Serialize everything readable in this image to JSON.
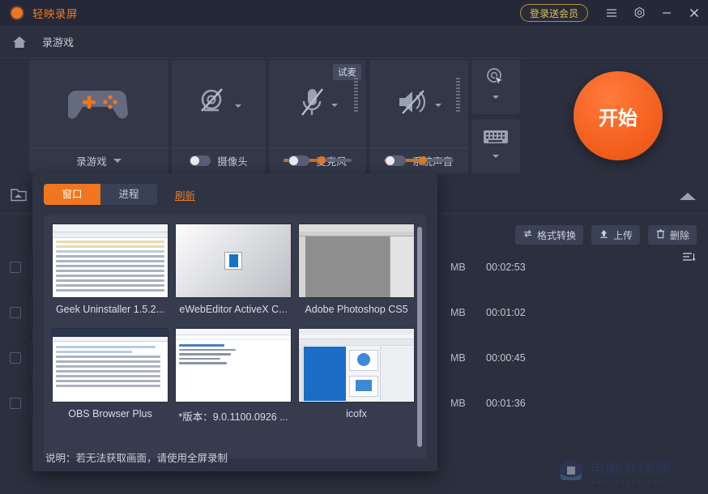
{
  "titlebar": {
    "app_title": "轻映录屏",
    "logo_icon": "record-dot-icon",
    "vip_button": "登录送会员",
    "menu_icon": "hamburger-menu-icon",
    "settings_icon": "gear-icon",
    "minimize_icon": "minimize-icon",
    "close_icon": "close-icon",
    "accent_color": "#f0761f",
    "vip_color": "#e0bf55"
  },
  "nav": {
    "home_icon": "home-icon",
    "tab_label": "录游戏"
  },
  "toolbar": {
    "game": {
      "icon": "gamepad-icon",
      "label": "录游戏",
      "caret_icon": "chevron-down-icon"
    },
    "camera": {
      "icon": "camera-off-icon",
      "label": "摄像头",
      "caret_icon": "chevron-down-icon",
      "enabled": false
    },
    "microphone": {
      "icon": "microphone-off-icon",
      "label": "麦克风",
      "caret_icon": "chevron-down-icon",
      "test_label": "试麦",
      "enabled": false,
      "volume": 56
    },
    "system_sound": {
      "icon": "speaker-off-icon",
      "label": "系统声音",
      "caret_icon": "chevron-down-icon",
      "enabled": false,
      "volume": 56
    },
    "cursor_panel": {
      "icon": "cursor-click-icon",
      "caret_icon": "chevron-down-icon"
    },
    "keyboard_panel": {
      "icon": "keyboard-icon",
      "caret_icon": "chevron-down-icon"
    },
    "start_button": {
      "label": "开始",
      "color": "#f4601f"
    }
  },
  "file_list": {
    "folder_icon": "open-folder-icon",
    "collapse_icon": "chevron-up-icon",
    "sort_icon": "sort-list-icon",
    "tools": [
      {
        "label": "格式转换",
        "icon": "convert-icon"
      },
      {
        "label": "上传",
        "icon": "upload-icon"
      },
      {
        "label": "删除",
        "icon": "trash-icon"
      }
    ],
    "rows": [
      {
        "size": "MB",
        "duration": "00:02:53"
      },
      {
        "size": "MB",
        "duration": "00:01:02"
      },
      {
        "size": "MB",
        "duration": "00:00:45"
      },
      {
        "size": "MB",
        "duration": "00:01:36"
      }
    ]
  },
  "popup": {
    "tabs": [
      {
        "label": "窗口",
        "active": true
      },
      {
        "label": "进程",
        "active": false
      }
    ],
    "refresh_label": "刷新",
    "note": "说明：若无法获取画面，请使用全屏录制",
    "windows": [
      {
        "caption": "Geek Uninstaller 1.5.2...",
        "style": "list"
      },
      {
        "caption": "eWebEditor ActiveX C...",
        "style": "gradient"
      },
      {
        "caption": "Adobe Photoshop CS5",
        "style": "photoshop"
      },
      {
        "caption": "OBS Browser Plus",
        "style": "browser"
      },
      {
        "caption": "*版本：9.0.1100.0926 ...",
        "style": "text"
      },
      {
        "caption": "icofx",
        "style": "icofx"
      }
    ]
  },
  "watermark": {
    "title": "电脑系统网",
    "url": "www.dnxtw.com",
    "icon": "house-logo-icon"
  }
}
